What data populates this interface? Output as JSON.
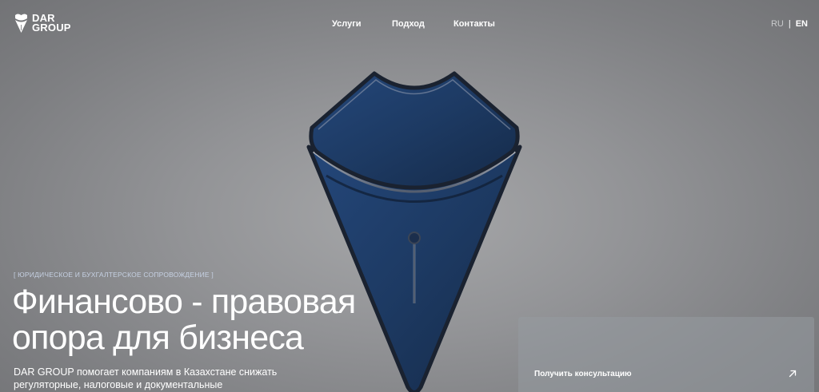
{
  "brand": {
    "logo_line1": "DAR",
    "logo_line2": "GROUP"
  },
  "nav": {
    "items": [
      {
        "label": "Услуги"
      },
      {
        "label": "Подход"
      },
      {
        "label": "Контакты"
      }
    ]
  },
  "language": {
    "options": [
      "RU",
      "EN"
    ],
    "active": "EN"
  },
  "hero": {
    "eyebrow": "[ ЮРИДИЧЕСКОЕ И БУХГАЛТЕРСКОЕ СОПРОВОЖДЕНИЕ ]",
    "headline_line1": "Финансово - правовая",
    "headline_line2": "опора для бизнеса",
    "description": "DAR GROUP помогает компаниям в Казахстане снижать регуляторные, налоговые и документальные"
  },
  "cta": {
    "label": "Получить консультацию",
    "icon": "arrow-up-right-icon"
  },
  "colors": {
    "background": "#8f9093",
    "pen_blue": "#1d3a63",
    "pen_outline": "#1a2230",
    "eyebrow_text": "#c6d1e3",
    "text": "#ffffff"
  }
}
